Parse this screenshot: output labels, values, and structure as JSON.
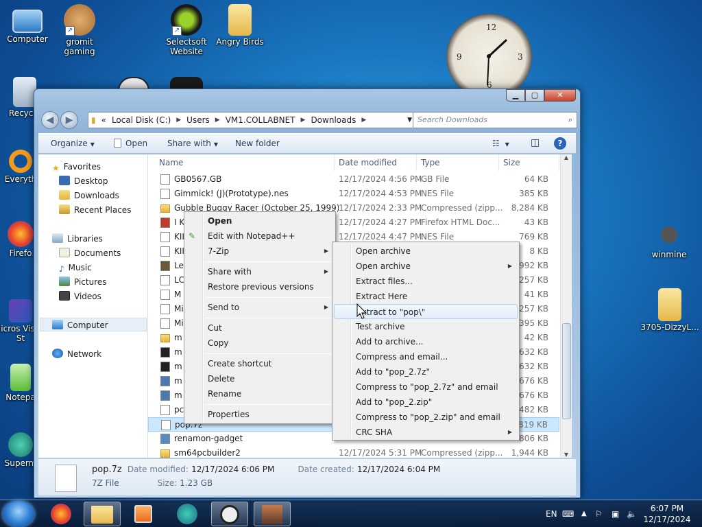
{
  "desktop": {
    "icons": [
      "Computer",
      "gromit gaming",
      "Selectsoft Website",
      "Angry Birds",
      "Recycle",
      "Everyth",
      "Firefo",
      "Micros Visual St",
      "Notepa",
      "Superm",
      "winmine",
      "3705-DizzyL..."
    ]
  },
  "window": {
    "address": [
      "Local Disk (C:)",
      "Users",
      "VM1.COLLABNET",
      "Downloads"
    ],
    "search_placeholder": "Search Downloads",
    "toolbar": {
      "organize": "Organize",
      "open": "Open",
      "share_with": "Share with",
      "new_folder": "New folder"
    },
    "nav": {
      "favorites": "Favorites",
      "desktop": "Desktop",
      "downloads": "Downloads",
      "recent_places": "Recent Places",
      "libraries": "Libraries",
      "documents": "Documents",
      "music": "Music",
      "pictures": "Pictures",
      "videos": "Videos",
      "computer": "Computer",
      "network": "Network"
    },
    "columns": {
      "name": "Name",
      "date": "Date modified",
      "type": "Type",
      "size": "Size"
    },
    "files": [
      {
        "name": "GB0567.GB",
        "date": "12/17/2024 4:56 PM",
        "type": "GB File",
        "size": "64 KB",
        "icon": "file"
      },
      {
        "name": "Gimmick! (J)(Prototype).nes",
        "date": "12/17/2024 4:53 PM",
        "type": "NES File",
        "size": "385 KB",
        "icon": "file"
      },
      {
        "name": "Gubble Buggy Racer (October 25, 1999)",
        "date": "12/17/2024 2:33 PM",
        "type": "Compressed (zipp...",
        "size": "8,284 KB",
        "icon": "folder"
      },
      {
        "name": "I K",
        "date": "12/17/2024 4:27 PM",
        "type": "Firefox HTML Doc...",
        "size": "43 KB",
        "icon": "html"
      },
      {
        "name": "KII",
        "date": "12/17/2024 4:47 PM",
        "type": "NES File",
        "size": "769 KB",
        "icon": "file"
      },
      {
        "name": "KII",
        "date": "",
        "type": "",
        "size": "8 KB",
        "icon": "file"
      },
      {
        "name": "Le",
        "date": "",
        "type": "",
        "size": "992 KB",
        "icon": "cube"
      },
      {
        "name": "LC",
        "date": "",
        "type": "",
        "size": "257 KB",
        "icon": "file"
      },
      {
        "name": "M",
        "date": "",
        "type": "",
        "size": "41 KB",
        "icon": "file"
      },
      {
        "name": "Mi",
        "date": "",
        "type": "",
        "size": "257 KB",
        "icon": "file"
      },
      {
        "name": "Mi",
        "date": "",
        "type": "",
        "size": "395 KB",
        "icon": "file"
      },
      {
        "name": "m",
        "date": "",
        "type": "",
        "size": "42 KB",
        "icon": "folder"
      },
      {
        "name": "m",
        "date": "",
        "type": "",
        "size": "632 KB",
        "icon": "7z"
      },
      {
        "name": "m",
        "date": "",
        "type": "",
        "size": "632 KB",
        "icon": "7z"
      },
      {
        "name": "m",
        "date": "",
        "type": "",
        "size": "676 KB",
        "icon": "setup"
      },
      {
        "name": "m",
        "date": "",
        "type": "",
        "size": "676 KB",
        "icon": "setup"
      },
      {
        "name": "pc",
        "date": "",
        "type": "",
        "size": "482 KB",
        "icon": "file"
      },
      {
        "name": "pop.7z",
        "date": "",
        "type": "",
        "size": "819 KB",
        "icon": "file"
      },
      {
        "name": "renamon-gadget",
        "date": "",
        "type": "",
        "size": "806 KB",
        "icon": "gadget"
      },
      {
        "name": "sm64pcbuilder2",
        "date": "12/17/2024 5:31 PM",
        "type": "Compressed (zipp...",
        "size": "1,944 KB",
        "icon": "folder"
      }
    ],
    "details": {
      "name": "pop.7z",
      "type": "7Z File",
      "date_modified_label": "Date modified:",
      "date_modified": "12/17/2024 6:06 PM",
      "date_created_label": "Date created:",
      "date_created": "12/17/2024 6:04 PM",
      "size_label": "Size:",
      "size": "1.23 GB"
    }
  },
  "context_menu": {
    "items": [
      "Open",
      "Edit with Notepad++",
      "7-Zip",
      "Share with",
      "Restore previous versions",
      "Send to",
      "Cut",
      "Copy",
      "Create shortcut",
      "Delete",
      "Rename",
      "Properties"
    ]
  },
  "submenu": {
    "items": [
      "Open archive",
      "Open archive",
      "Extract files...",
      "Extract Here",
      "Extract to \"pop\\\"",
      "Test archive",
      "Add to archive...",
      "Compress and email...",
      "Add to \"pop_2.7z\"",
      "Compress to \"pop_2.7z\" and email",
      "Add to \"pop_2.zip\"",
      "Compress to \"pop_2.zip\" and email",
      "CRC SHA"
    ]
  },
  "taskbar": {
    "lang": "EN",
    "time": "6:07 PM",
    "date": "12/17/2024"
  },
  "colors": {
    "accent": "#1a78c2",
    "selection": "#cce8ff",
    "menu_hover": "#e2eefb"
  }
}
